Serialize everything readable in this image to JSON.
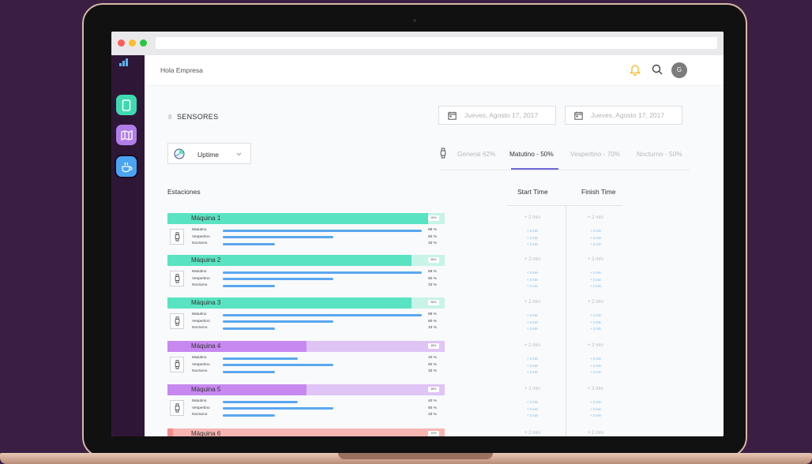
{
  "app": {
    "greeting": "Hola Empresa",
    "avatar_initial": "G"
  },
  "colors": {
    "accent": "#6b66d6",
    "green": "#5ae3c2",
    "purple": "#c788ef",
    "purple_light": "#dfc4f6",
    "pink": "#f7b5b2",
    "blue_bar": "#5aa7ef",
    "bell": "#f5b623"
  },
  "sidebar": {
    "items": [
      {
        "name": "tablet-icon",
        "color": "#3dd9b0"
      },
      {
        "name": "map-icon",
        "color": "#b07de8"
      },
      {
        "name": "coffee-icon",
        "color": "#4ba4f2"
      }
    ]
  },
  "header": {
    "sensor_count": "8",
    "sensor_label": "SENSORES",
    "date_start": "Jueves, Agosto 17, 2017",
    "date_end": "Jueves, Agosto 17, 2017",
    "metric": "Uptime"
  },
  "tabs": [
    {
      "label": "General 62%",
      "active": false
    },
    {
      "label": "Matutino - 50%",
      "active": true
    },
    {
      "label": "Vespertino - 70%",
      "active": false
    },
    {
      "label": "Nocturno - 50%",
      "active": false
    }
  ],
  "columns": {
    "stations": "Estaciones",
    "start": "Start Time",
    "finish": "Finish Time"
  },
  "machines": [
    {
      "name": "Máquina 1",
      "pct_label": "90%",
      "fill": 0.94,
      "color": "green",
      "shifts": [
        {
          "label": "Matutino",
          "value": "88 %",
          "frac": 0.88
        },
        {
          "label": "Vespertino",
          "value": "60 %",
          "frac": 0.49
        },
        {
          "label": "Nocturno",
          "value": "33 %",
          "frac": 0.23
        }
      ],
      "time_main": "+ 2 min",
      "time_sub": [
        "+ 2 min",
        "+ 2 min",
        "+ 2 min"
      ]
    },
    {
      "name": "Máquina 2",
      "pct_label": "80%",
      "fill": 0.88,
      "color": "green",
      "shifts": [
        {
          "label": "Matutino",
          "value": "88 %",
          "frac": 0.88
        },
        {
          "label": "Vespertino",
          "value": "60 %",
          "frac": 0.49
        },
        {
          "label": "Nocturno",
          "value": "33 %",
          "frac": 0.23
        }
      ],
      "time_main": "+ 2 min",
      "time_sub": [
        "+ 2 min",
        "+ 2 min",
        "+ 2 min"
      ]
    },
    {
      "name": "Máquina 3",
      "pct_label": "80%",
      "fill": 0.88,
      "color": "green",
      "shifts": [
        {
          "label": "Matutino",
          "value": "88 %",
          "frac": 0.88
        },
        {
          "label": "Vespertino",
          "value": "60 %",
          "frac": 0.49
        },
        {
          "label": "Nocturno",
          "value": "33 %",
          "frac": 0.23
        }
      ],
      "time_main": "+ 2 min",
      "time_sub": [
        "+ 2 min",
        "+ 2 min",
        "+ 2 min"
      ]
    },
    {
      "name": "Máquina 4",
      "pct_label": "48%",
      "fill": 0.5,
      "color": "purple",
      "shifts": [
        {
          "label": "Matutino",
          "value": "40 %",
          "frac": 0.33
        },
        {
          "label": "Vespertino",
          "value": "60 %",
          "frac": 0.49
        },
        {
          "label": "Nocturno",
          "value": "33 %",
          "frac": 0.23
        }
      ],
      "time_main": "+ 2 min",
      "time_sub": [
        "+ 2 min",
        "+ 2 min",
        "+ 2 min"
      ]
    },
    {
      "name": "Máquina 5",
      "pct_label": "48%",
      "fill": 0.5,
      "color": "purple",
      "shifts": [
        {
          "label": "Matutino",
          "value": "40 %",
          "frac": 0.33
        },
        {
          "label": "Vespertino",
          "value": "60 %",
          "frac": 0.49
        },
        {
          "label": "Nocturno",
          "value": "33 %",
          "frac": 0.23
        }
      ],
      "time_main": "+ 2 min",
      "time_sub": [
        "+ 2 min",
        "+ 2 min",
        "+ 2 min"
      ]
    },
    {
      "name": "Máquina 6",
      "pct_label": "10%",
      "fill": 0.02,
      "color": "pink",
      "shifts": [],
      "time_main": "+ 2 min",
      "time_sub": []
    }
  ]
}
